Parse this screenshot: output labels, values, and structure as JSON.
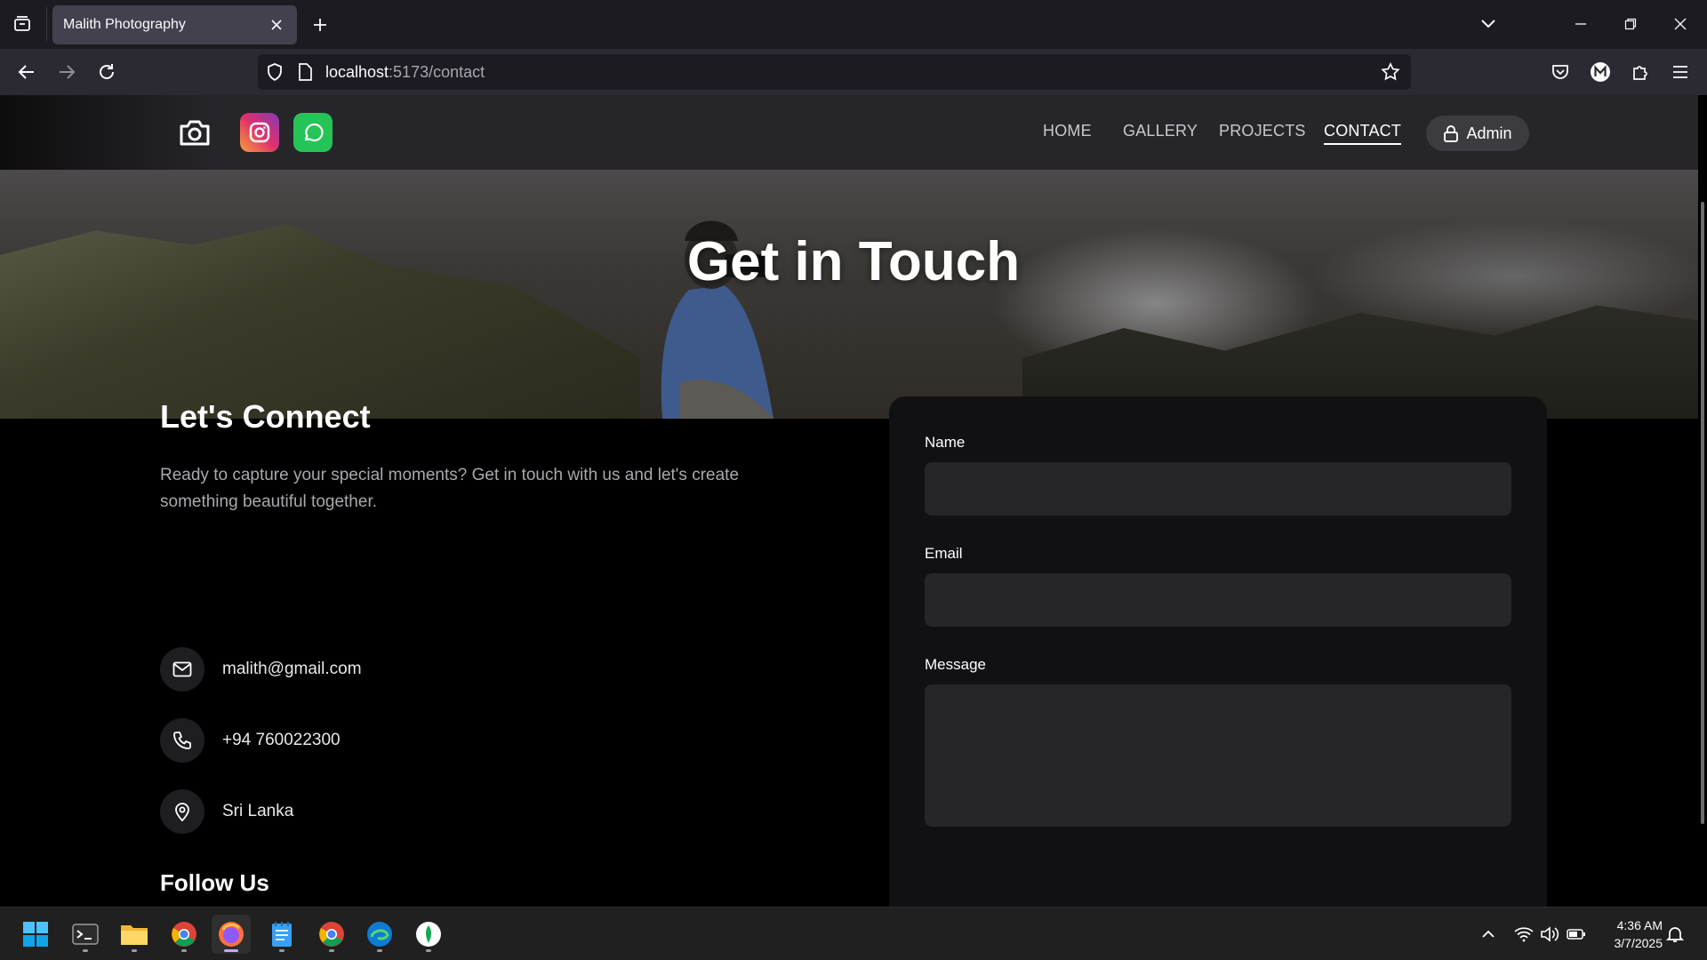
{
  "browser": {
    "tab_title": "Malith Photography",
    "url_host": "localhost",
    "url_path": ":5173/contact"
  },
  "site": {
    "nav": {
      "home": "HOME",
      "gallery": "GALLERY",
      "projects": "PROJECTS",
      "contact": "CONTACT",
      "admin": "Admin"
    },
    "hero_title": "Get in Touch",
    "connect": {
      "title": "Let's Connect",
      "description": "Ready to capture your special moments? Get in touch with us and let's create something beautiful together.",
      "email": "malith@gmail.com",
      "phone": "+94 760022300",
      "location": "Sri Lanka",
      "follow_title": "Follow Us"
    },
    "form": {
      "name_label": "Name",
      "name_value": "",
      "email_label": "Email",
      "email_value": "",
      "message_label": "Message",
      "message_value": ""
    }
  },
  "taskbar": {
    "apps": [
      "start-icon",
      "terminal-icon",
      "file-explorer-icon",
      "chrome-icon",
      "firefox-icon",
      "notepad-icon",
      "chrome-icon",
      "edge-icon",
      "mongodb-icon"
    ],
    "time": "4:36 AM",
    "date": "3/7/2025"
  },
  "colors": {
    "whatsapp": "#25c457",
    "page_bg": "#000000",
    "card_bg": "#111113",
    "input_bg": "#262628"
  }
}
